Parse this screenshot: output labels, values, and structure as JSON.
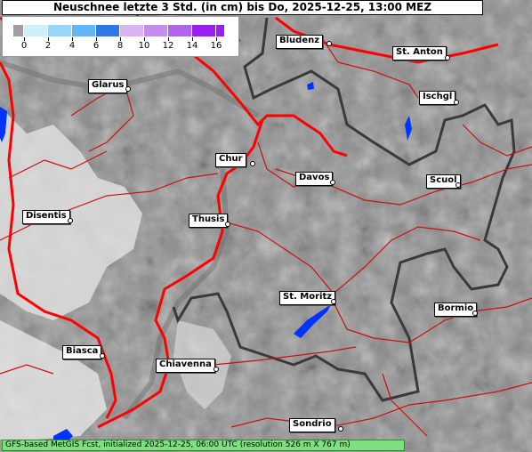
{
  "title": "Neuschnee letzte 3 Std. (in cm) bis Do, 2025-12-25, 13:00 MEZ",
  "legend": {
    "ticks": [
      "0",
      "2",
      "4",
      "6",
      "8",
      "10",
      "12",
      "14",
      "16"
    ],
    "colors": [
      "#9f9f9f",
      "#cfeffd",
      "#9ad6fa",
      "#61b7f4",
      "#2e79e6",
      "#d8b4f0",
      "#c58ded",
      "#b064e9",
      "#9a1eef"
    ]
  },
  "cities": [
    {
      "name": "Bludenz"
    },
    {
      "name": "St. Anton"
    },
    {
      "name": "Glarus"
    },
    {
      "name": "Ischgl"
    },
    {
      "name": "Chur"
    },
    {
      "name": "Davos"
    },
    {
      "name": "Scuol"
    },
    {
      "name": "Disentis"
    },
    {
      "name": "Thusis"
    },
    {
      "name": "St. Moritz"
    },
    {
      "name": "Bormio"
    },
    {
      "name": "Biasca"
    },
    {
      "name": "Chiavenna"
    },
    {
      "name": "Sondrio"
    }
  ],
  "footer": "GFS-based MetGIS Fcst, initialized 2025-12-25, 06:00 UTC  (resolution 526 m X 767 m)",
  "colors": {
    "terrain": "#8c8c8c",
    "snow_cover": "#e4e4e4",
    "major_road": "#ff0000",
    "minor_road": "#d01818",
    "border": "#404040",
    "lake": "#0033ff",
    "footer_bg": "#7fe07f"
  }
}
